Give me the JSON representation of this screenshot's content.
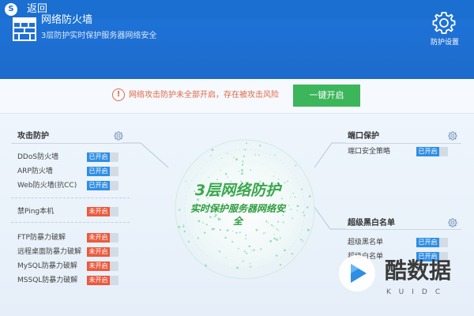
{
  "topbar": {
    "back_label": "返回"
  },
  "header": {
    "title": "网络防火墙",
    "subtitle": "3层防护实时保护服务器网络安全",
    "settings_label": "防护设置"
  },
  "alert": {
    "text": "网络攻击防护未全部开启，存在被攻击风险",
    "button": "一键开启"
  },
  "center": {
    "line1": "3层网络防护",
    "line2": "实时保护服务器网络安全"
  },
  "attack": {
    "title": "攻击防护",
    "items": [
      {
        "label": "DDoS防火墙",
        "status": "已开启"
      },
      {
        "label": "ARP防火墙",
        "status": "已开启"
      },
      {
        "label": "Web防火墙(抗CC)",
        "status": "已开启"
      }
    ],
    "ping": {
      "label": "禁Ping本机",
      "status": "未开启"
    },
    "brute": [
      {
        "label": "FTP防暴力破解",
        "status": "未开启"
      },
      {
        "label": "远程桌面防暴力破解",
        "status": "未开启"
      },
      {
        "label": "MySQL防暴力破解",
        "status": "未开启"
      },
      {
        "label": "MSSQL防暴力破解",
        "status": "未开启"
      }
    ]
  },
  "port": {
    "title": "端口保护",
    "items": [
      {
        "label": "端口安全策略",
        "status": "已开启"
      }
    ]
  },
  "blacklist": {
    "title": "超级黑白名单",
    "items": [
      {
        "label": "超级黑名单",
        "status": "已开启"
      },
      {
        "label": "超级白名单",
        "status": "已开启"
      }
    ]
  },
  "watermark": {
    "name": "酷数据",
    "sub": "KUIDC"
  },
  "colors": {
    "primary": "#1a6fd1",
    "on": "#2f8ee5",
    "off": "#ea5a3d",
    "cta": "#3cb55b",
    "warn": "#e06a4a"
  }
}
